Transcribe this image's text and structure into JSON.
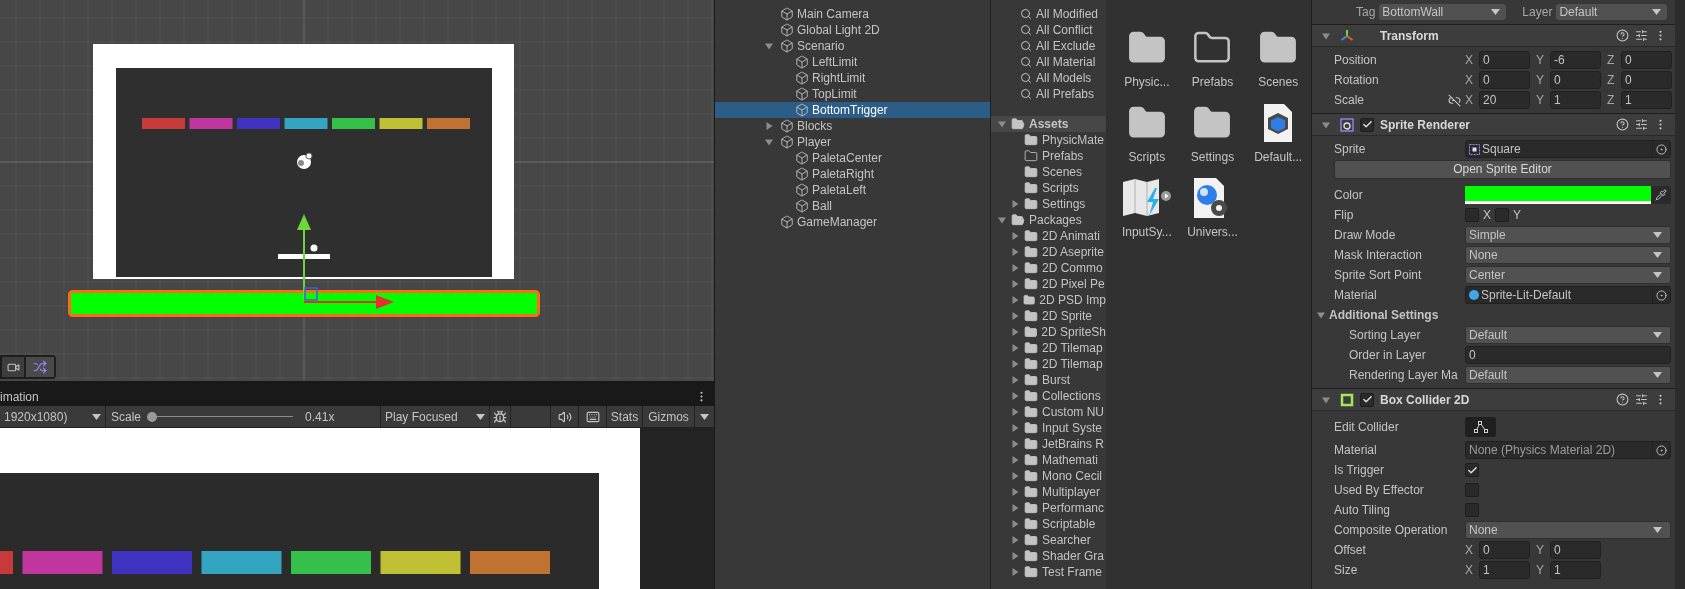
{
  "scene_view": {
    "blocks": [
      {
        "color": "#c83a3a"
      },
      {
        "color": "#c0369e"
      },
      {
        "color": "#4032c0"
      },
      {
        "color": "#33a5c0"
      },
      {
        "color": "#35c04b"
      },
      {
        "color": "#bfc034"
      },
      {
        "color": "#c07232"
      }
    ]
  },
  "game_view": {
    "tab": "imation",
    "resolution": "1920x1080)",
    "scale": {
      "label": "Scale",
      "level": 0,
      "reading": "0.41x"
    },
    "play_mode": "Play Focused",
    "stats": "Stats",
    "gizmos": "Gizmos",
    "blocks": [
      {
        "color": "#c83a3a"
      },
      {
        "color": "#c0369e"
      },
      {
        "color": "#4032c0"
      },
      {
        "color": "#33a5c0"
      },
      {
        "color": "#35c04b"
      },
      {
        "color": "#bfc034"
      },
      {
        "color": "#c07232"
      }
    ]
  },
  "hierarchy": {
    "items": [
      {
        "label": "Main Camera",
        "selected": false
      },
      {
        "label": "Global Light 2D",
        "selected": false
      },
      {
        "label": "Scenario",
        "selected": false,
        "expanded": true,
        "children": [
          {
            "label": "LeftLimit",
            "selected": false
          },
          {
            "label": "RightLimit",
            "selected": false
          },
          {
            "label": "TopLimit",
            "selected": false
          },
          {
            "label": "BottomTrigger",
            "selected": true
          }
        ]
      },
      {
        "label": "Blocks",
        "selected": false,
        "expanded": false
      },
      {
        "label": "Player",
        "selected": false,
        "expanded": true,
        "children": [
          {
            "label": "PaletaCenter",
            "selected": false
          },
          {
            "label": "PaletaRight",
            "selected": false
          },
          {
            "label": "PaletaLeft",
            "selected": false
          },
          {
            "label": "Ball",
            "selected": false
          }
        ]
      },
      {
        "label": "GameManager",
        "selected": false
      }
    ]
  },
  "project": {
    "favorites": [
      "All Modified",
      "All Conflict",
      "All Exclude",
      "All Material",
      "All Models",
      "All Prefabs"
    ],
    "tree": [
      {
        "label": "Assets",
        "selected": true,
        "expanded": true,
        "children": [
          {
            "label": "PhysicMate",
            "kind": "folder",
            "selected": false
          },
          {
            "label": "Prefabs",
            "kind": "empty_folder",
            "selected": false
          },
          {
            "label": "Scenes",
            "kind": "folder",
            "selected": false
          },
          {
            "label": "Scripts",
            "kind": "folder",
            "selected": false
          },
          {
            "label": "Settings",
            "kind": "folder",
            "selected": false,
            "expanded": false
          }
        ]
      },
      {
        "label": "Packages",
        "selected": false,
        "expanded": true,
        "children": [
          {
            "label": "2D Animati",
            "kind": "folder",
            "selected": false,
            "expanded": false
          },
          {
            "label": "2D Aseprite",
            "kind": "folder",
            "selected": false,
            "expanded": false
          },
          {
            "label": "2D Commo",
            "kind": "folder",
            "selected": false,
            "expanded": false
          },
          {
            "label": "2D Pixel Pe",
            "kind": "folder",
            "selected": false,
            "expanded": false
          },
          {
            "label": "2D PSD Imp",
            "kind": "folder",
            "selected": false,
            "expanded": false
          },
          {
            "label": "2D Sprite",
            "kind": "folder",
            "selected": false,
            "expanded": false
          },
          {
            "label": "2D SpriteSh",
            "kind": "folder",
            "selected": false,
            "expanded": false
          },
          {
            "label": "2D Tilemap",
            "kind": "folder",
            "selected": false,
            "expanded": false
          },
          {
            "label": "2D Tilemap",
            "kind": "folder",
            "selected": false,
            "expanded": false
          },
          {
            "label": "Burst",
            "kind": "folder",
            "selected": false,
            "expanded": false
          },
          {
            "label": "Collections",
            "kind": "folder",
            "selected": false,
            "expanded": false
          },
          {
            "label": "Custom NU",
            "kind": "folder",
            "selected": false,
            "expanded": false
          },
          {
            "label": "Input Syste",
            "kind": "folder",
            "selected": false,
            "expanded": false
          },
          {
            "label": "JetBrains R",
            "kind": "folder",
            "selected": false,
            "expanded": false
          },
          {
            "label": "Mathemati",
            "kind": "folder",
            "selected": false,
            "expanded": false
          },
          {
            "label": "Mono Cecil",
            "kind": "folder",
            "selected": false,
            "expanded": false
          },
          {
            "label": "Multiplayer",
            "kind": "folder",
            "selected": false,
            "expanded": false
          },
          {
            "label": "Performanc",
            "kind": "folder",
            "selected": false,
            "expanded": false
          },
          {
            "label": "Scriptable",
            "kind": "folder",
            "selected": false,
            "expanded": false
          },
          {
            "label": "Searcher",
            "kind": "folder",
            "selected": false,
            "expanded": false
          },
          {
            "label": "Shader Gra",
            "kind": "folder",
            "selected": false,
            "expanded": false
          },
          {
            "label": "Test Frame",
            "kind": "folder",
            "selected": false,
            "expanded": false
          }
        ]
      }
    ],
    "assets": [
      {
        "label": "Physic...",
        "kind": "folder"
      },
      {
        "label": "Prefabs",
        "kind": "empty_folder"
      },
      {
        "label": "Scenes",
        "kind": "folder"
      },
      {
        "label": "Scripts",
        "kind": "folder"
      },
      {
        "label": "Settings",
        "kind": "folder"
      },
      {
        "label": "Default...",
        "kind": "model"
      },
      {
        "label": "InputSy...",
        "kind": "input_actions"
      },
      {
        "label": "Univers...",
        "kind": "pipeline"
      }
    ]
  },
  "inspector": {
    "tag": {
      "label": "Tag",
      "value": "BottomWall"
    },
    "layer": {
      "label": "Layer",
      "value": "Default"
    },
    "components": [
      {
        "title": "Transform",
        "kind": "transform",
        "expanded": true,
        "rows": [
          {
            "kind": "vector3",
            "label": "Position",
            "axes": [
              {
                "axis": "X",
                "value": "0"
              },
              {
                "axis": "Y",
                "value": "-6"
              },
              {
                "axis": "Z",
                "value": "0"
              }
            ]
          },
          {
            "kind": "vector3",
            "label": "Rotation",
            "axes": [
              {
                "axis": "X",
                "value": "0"
              },
              {
                "axis": "Y",
                "value": "0"
              },
              {
                "axis": "Z",
                "value": "0"
              }
            ]
          },
          {
            "kind": "vector3",
            "label": "Scale",
            "linked": false,
            "axes": [
              {
                "axis": "X",
                "value": "20"
              },
              {
                "axis": "Y",
                "value": "1"
              },
              {
                "axis": "Z",
                "value": "1"
              }
            ]
          }
        ]
      },
      {
        "title": "Sprite Renderer",
        "kind": "sprite_renderer",
        "expanded": true,
        "enabled": true,
        "rows": [
          {
            "kind": "sprite_field",
            "label": "Sprite",
            "value": "Square"
          },
          {
            "kind": "button",
            "label": "Open Sprite Editor"
          },
          {
            "kind": "color",
            "label": "Color",
            "color": "#00ff00"
          },
          {
            "kind": "flip",
            "label": "Flip",
            "axes": [
              {
                "axis": "X",
                "checked": false
              },
              {
                "axis": "Y",
                "checked": false
              }
            ]
          },
          {
            "kind": "dropdown",
            "label": "Draw Mode",
            "value": "Simple"
          },
          {
            "kind": "dropdown",
            "label": "Mask Interaction",
            "value": "None"
          },
          {
            "kind": "dropdown",
            "label": "Sprite Sort Point",
            "value": "Center"
          },
          {
            "kind": "material_field",
            "label": "Material",
            "value": "Sprite-Lit-Default"
          },
          {
            "kind": "group",
            "label": "Additional Settings",
            "expanded": true,
            "children": [
              {
                "kind": "dropdown",
                "label": "Sorting Layer",
                "value": "Default"
              },
              {
                "kind": "number",
                "label": "Order in Layer",
                "value": "0"
              },
              {
                "kind": "dropdown",
                "label": "Rendering Layer Ma",
                "value": "Default"
              }
            ]
          }
        ]
      },
      {
        "title": "Box Collider 2D",
        "kind": "box_collider",
        "expanded": true,
        "enabled": true,
        "rows": [
          {
            "kind": "edit_collider",
            "label": "Edit Collider"
          },
          {
            "kind": "asset_field",
            "label": "Material",
            "value": "None (Physics Material 2D)"
          },
          {
            "kind": "checkbox",
            "label": "Is Trigger",
            "checked": true
          },
          {
            "kind": "checkbox",
            "label": "Used By Effector",
            "checked": false
          },
          {
            "kind": "checkbox",
            "label": "Auto Tiling",
            "checked": false
          },
          {
            "kind": "dropdown",
            "label": "Composite Operation",
            "value": "None"
          },
          {
            "kind": "vector2",
            "label": "Offset",
            "axes": [
              {
                "axis": "X",
                "value": "0"
              },
              {
                "axis": "Y",
                "value": "0"
              }
            ]
          },
          {
            "kind": "vector2",
            "label": "Size",
            "axes": [
              {
                "axis": "X",
                "value": "1"
              },
              {
                "axis": "Y",
                "value": "1"
              }
            ]
          }
        ]
      }
    ]
  }
}
